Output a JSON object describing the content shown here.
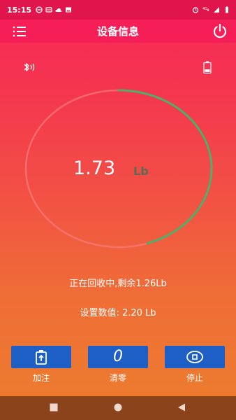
{
  "status_bar": {
    "time": "15:15",
    "left_icons": [
      "minus-circle-icon",
      "wifi-tag-icon",
      "cloud-icon",
      "image-icon"
    ],
    "right_icons": [
      "alarm-icon",
      "network-4g-icon",
      "signal-icon",
      "battery-icon"
    ]
  },
  "app_bar": {
    "title": "设备信息"
  },
  "gauge": {
    "reading": "1.73",
    "unit": "Lb",
    "progress": 0.45,
    "colors": {
      "track": "#f77a7a",
      "progress": "#4caf6a"
    }
  },
  "status_text": "正在回收中,剩余1.26Lb",
  "setting_text": "设置数值: 2.20 Lb",
  "controls": [
    {
      "label": "加注",
      "icon": "fill-up-icon"
    },
    {
      "label": "清零",
      "icon": "zero-icon",
      "glyph": "0"
    },
    {
      "label": "停止",
      "icon": "stop-icon"
    }
  ],
  "nav": [
    "recents-square-icon",
    "home-circle-icon",
    "back-triangle-icon"
  ]
}
